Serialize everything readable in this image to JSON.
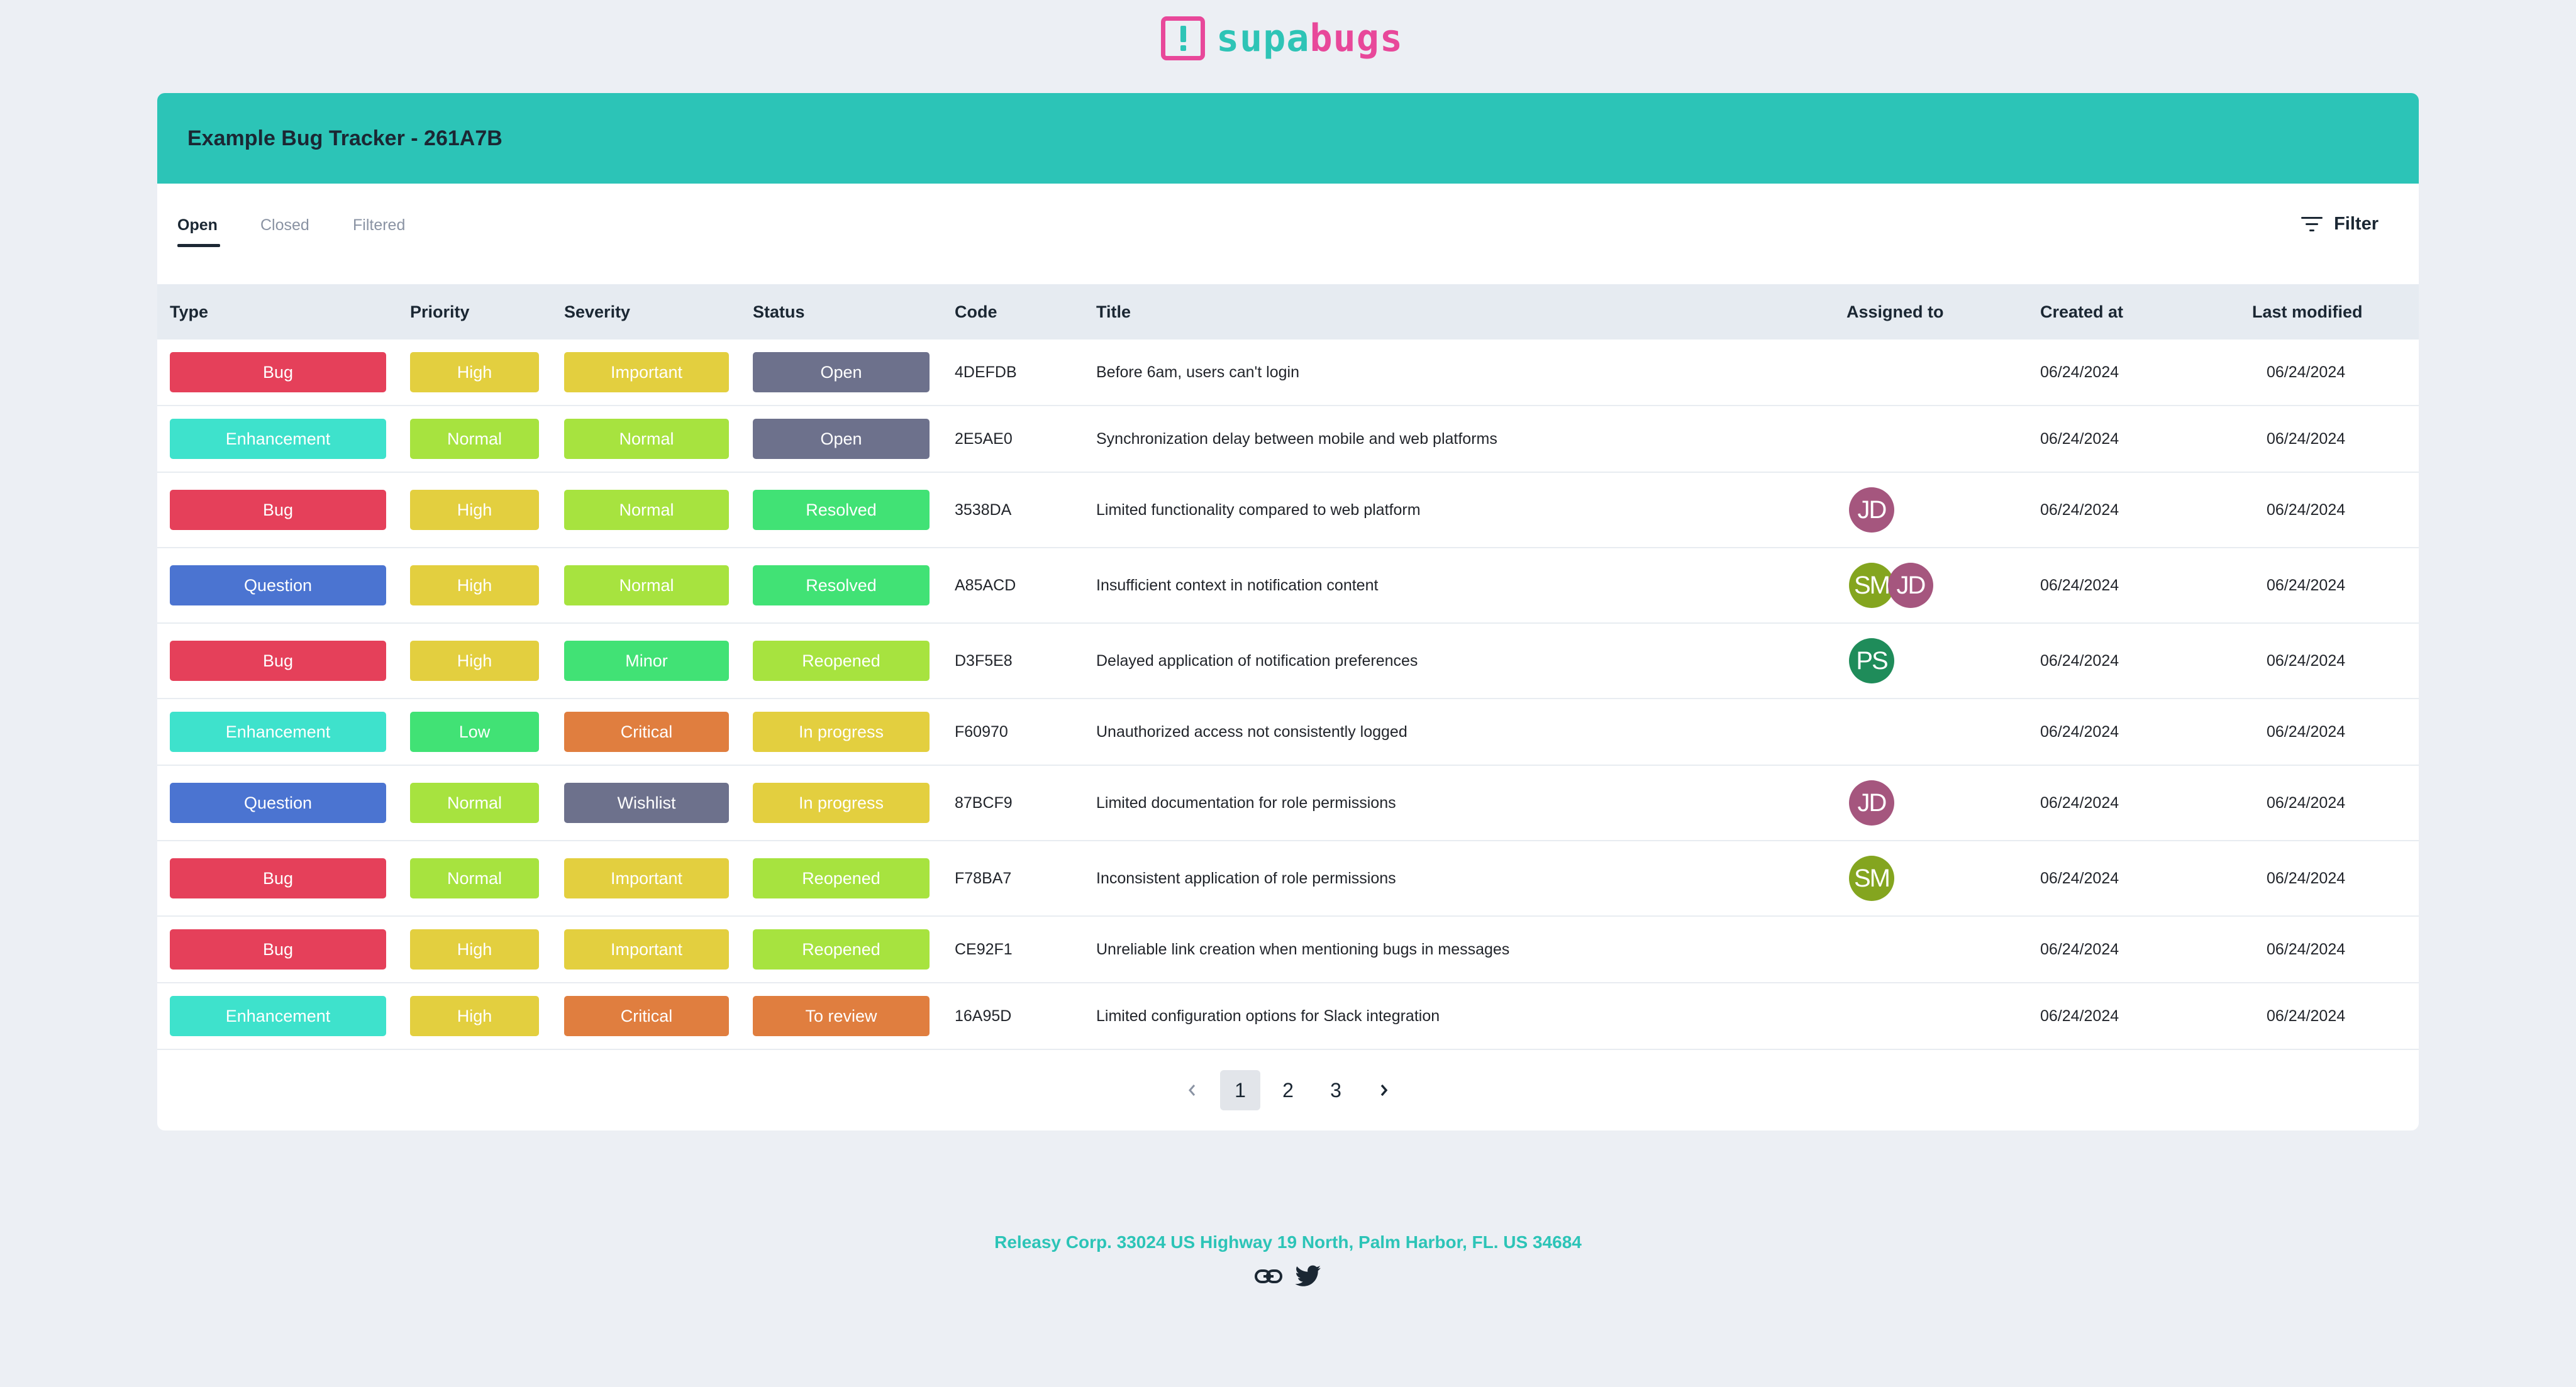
{
  "brand": {
    "logo_part1": "supa",
    "logo_part2": "bugs",
    "logo_icon": "exclamation-square-icon",
    "colors": {
      "teal": "#2cc4b7",
      "pink": "#e8489a"
    }
  },
  "tracker": {
    "title": "Example Bug Tracker - 261A7B"
  },
  "tabs": [
    {
      "label": "Open",
      "active": true
    },
    {
      "label": "Closed",
      "active": false
    },
    {
      "label": "Filtered",
      "active": false
    }
  ],
  "filter": {
    "label": "Filter",
    "icon": "filter-lines-icon"
  },
  "columns": {
    "type": "Type",
    "priority": "Priority",
    "severity": "Severity",
    "status": "Status",
    "code": "Code",
    "title": "Title",
    "assigned": "Assigned to",
    "created": "Created at",
    "modified": "Last modified"
  },
  "chip_colors": {
    "Bug": "#e5405a",
    "Enhancement": "#3ee2cc",
    "Question": "#4b74d1",
    "High": "#e3cf3f",
    "Normal": "#a7e33f",
    "Low": "#41e275",
    "Important": "#e3cf3f",
    "Minor": "#41e275",
    "Critical": "#e07e3f",
    "Wishlist": "#6d718c",
    "Open": "#6d718c",
    "Resolved": "#41e275",
    "Reopened": "#a7e33f",
    "In progress": "#e3cf3f",
    "To review": "#e07e3f"
  },
  "avatar_colors": {
    "JD": "#a5567e",
    "SM": "#84a51f",
    "PS": "#1f8c5a"
  },
  "rows": [
    {
      "type": "Bug",
      "priority": "High",
      "severity": "Important",
      "status": "Open",
      "code": "4DEFDB",
      "title": "Before 6am, users can't login",
      "assigned": [],
      "created": "06/24/2024",
      "modified": "06/24/2024"
    },
    {
      "type": "Enhancement",
      "priority": "Normal",
      "severity": "Normal",
      "status": "Open",
      "code": "2E5AE0",
      "title": "Synchronization delay between mobile and web platforms",
      "assigned": [],
      "created": "06/24/2024",
      "modified": "06/24/2024"
    },
    {
      "type": "Bug",
      "priority": "High",
      "severity": "Normal",
      "status": "Resolved",
      "code": "3538DA",
      "title": "Limited functionality compared to web platform",
      "assigned": [
        "JD"
      ],
      "created": "06/24/2024",
      "modified": "06/24/2024"
    },
    {
      "type": "Question",
      "priority": "High",
      "severity": "Normal",
      "status": "Resolved",
      "code": "A85ACD",
      "title": "Insufficient context in notification content",
      "assigned": [
        "SM",
        "JD"
      ],
      "created": "06/24/2024",
      "modified": "06/24/2024"
    },
    {
      "type": "Bug",
      "priority": "High",
      "severity": "Minor",
      "status": "Reopened",
      "code": "D3F5E8",
      "title": "Delayed application of notification preferences",
      "assigned": [
        "PS"
      ],
      "created": "06/24/2024",
      "modified": "06/24/2024"
    },
    {
      "type": "Enhancement",
      "priority": "Low",
      "severity": "Critical",
      "status": "In progress",
      "code": "F60970",
      "title": "Unauthorized access not consistently logged",
      "assigned": [],
      "created": "06/24/2024",
      "modified": "06/24/2024"
    },
    {
      "type": "Question",
      "priority": "Normal",
      "severity": "Wishlist",
      "status": "In progress",
      "code": "87BCF9",
      "title": "Limited documentation for role permissions",
      "assigned": [
        "JD"
      ],
      "created": "06/24/2024",
      "modified": "06/24/2024"
    },
    {
      "type": "Bug",
      "priority": "Normal",
      "severity": "Important",
      "status": "Reopened",
      "code": "F78BA7",
      "title": "Inconsistent application of role permissions",
      "assigned": [
        "SM"
      ],
      "created": "06/24/2024",
      "modified": "06/24/2024"
    },
    {
      "type": "Bug",
      "priority": "High",
      "severity": "Important",
      "status": "Reopened",
      "code": "CE92F1",
      "title": "Unreliable link creation when mentioning bugs in messages",
      "assigned": [],
      "created": "06/24/2024",
      "modified": "06/24/2024"
    },
    {
      "type": "Enhancement",
      "priority": "High",
      "severity": "Critical",
      "status": "To review",
      "code": "16A95D",
      "title": "Limited configuration options for Slack integration",
      "assigned": [],
      "created": "06/24/2024",
      "modified": "06/24/2024"
    }
  ],
  "pagination": {
    "pages": [
      "1",
      "2",
      "3"
    ],
    "current": "1",
    "prev_icon": "chevron-left-icon",
    "next_icon": "chevron-right-icon"
  },
  "footer": {
    "address": "Releasy Corp. 33024 US Highway 19 North, Palm Harbor, FL. US 34684",
    "icons": [
      "link-icon",
      "twitter-icon"
    ]
  }
}
